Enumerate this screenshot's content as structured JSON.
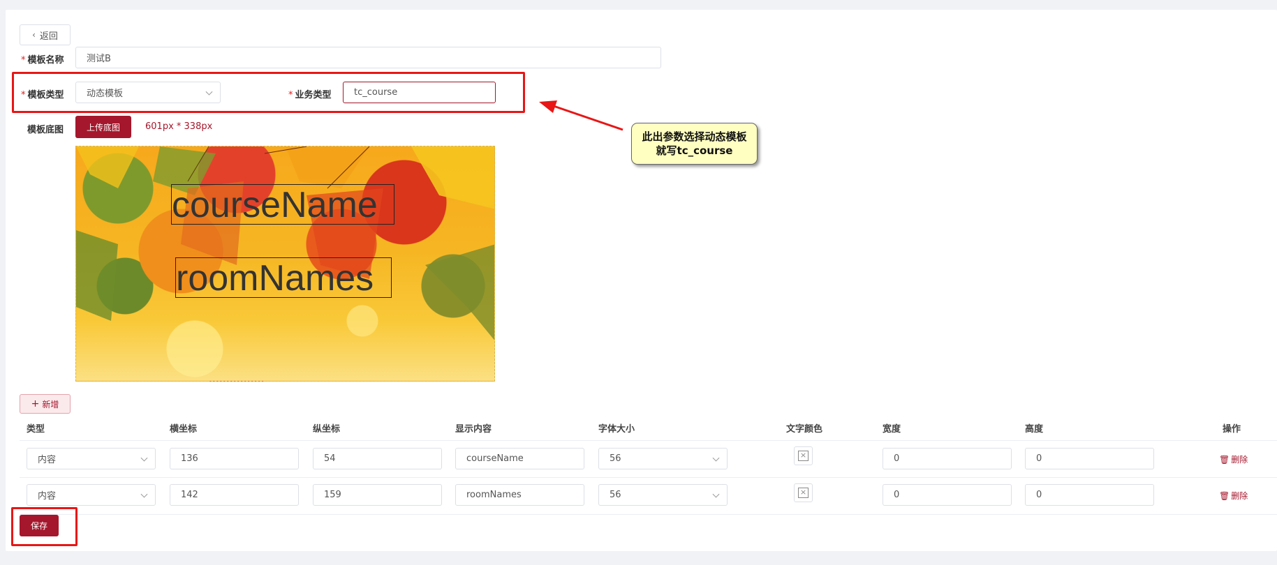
{
  "back_label": "返回",
  "form": {
    "name_label": "模板名称",
    "name_value": "测试B",
    "type_label": "模板类型",
    "type_value": "动态模板",
    "biz_label": "业务类型",
    "biz_value": "tc_course",
    "bg_label": "模板底图",
    "upload_label": "上传底图",
    "size_text": "601px * 338px",
    "required_mark": "*"
  },
  "preview": {
    "overlays": [
      {
        "text": "courseName"
      },
      {
        "text": "roomNames"
      }
    ]
  },
  "add_label": "新增",
  "table": {
    "headers": [
      "类型",
      "横坐标",
      "纵坐标",
      "显示内容",
      "字体大小",
      "文字颜色",
      "宽度",
      "高度",
      "操作"
    ],
    "rows": [
      {
        "type": "内容",
        "x": "136",
        "y": "54",
        "content": "courseName",
        "font_size": "56",
        "width": "0",
        "height": "0",
        "action": "删除"
      },
      {
        "type": "内容",
        "x": "142",
        "y": "159",
        "content": "roomNames",
        "font_size": "56",
        "width": "0",
        "height": "0",
        "action": "删除"
      }
    ]
  },
  "save_label": "保存",
  "annotation": {
    "callout_text": "此出参数选择动态模板就写tc_course",
    "highlight_color": "#e81616"
  },
  "colors": {
    "primary": "#a5172c",
    "callout_bg": "#ffffc2"
  }
}
